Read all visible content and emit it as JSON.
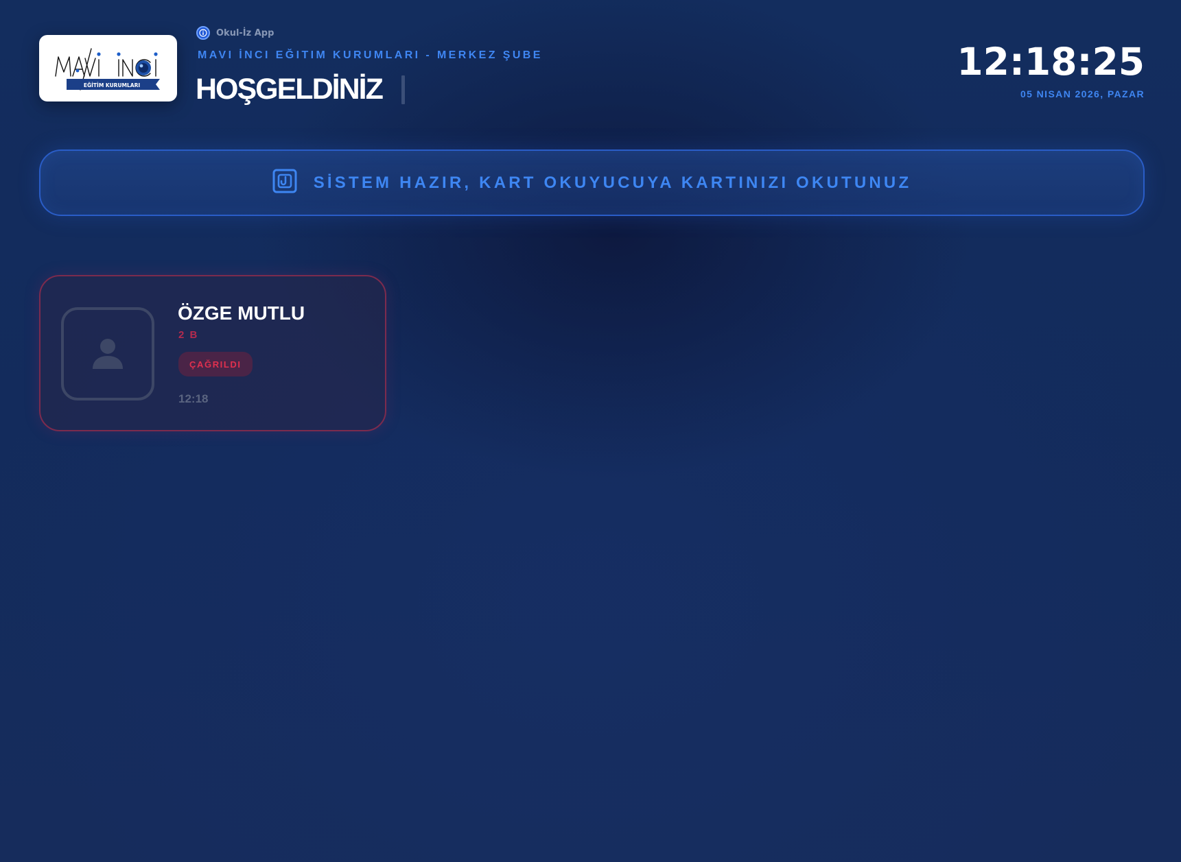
{
  "header": {
    "logo": {
      "brand_text": "MAVİ İNCİ",
      "sub_text": "EĞİTİM KURUMLARI"
    },
    "app_name": "Okul-İz App",
    "school_name": "MAVI İNCI EĞITIM KURUMLARI - MERKEZ ŞUBE",
    "welcome_title": "HOŞGELDİNİZ",
    "clock": "12:18:25",
    "date": "05 NISAN 2026, PAZAR"
  },
  "status_banner": {
    "icon": "nfc-card-icon",
    "text": "SİSTEM HAZIR, KART OKUYUCUYA KARTINIZI OKUTUNUZ"
  },
  "students": [
    {
      "name": "ÖZGE MUTLU",
      "class": "2 B",
      "status": "ÇAĞRILDI",
      "time": "12:18",
      "avatar_icon": "person-icon"
    }
  ],
  "colors": {
    "accent_blue": "#3e86f2",
    "called_red": "#e0304f",
    "background": "#132d5e"
  }
}
